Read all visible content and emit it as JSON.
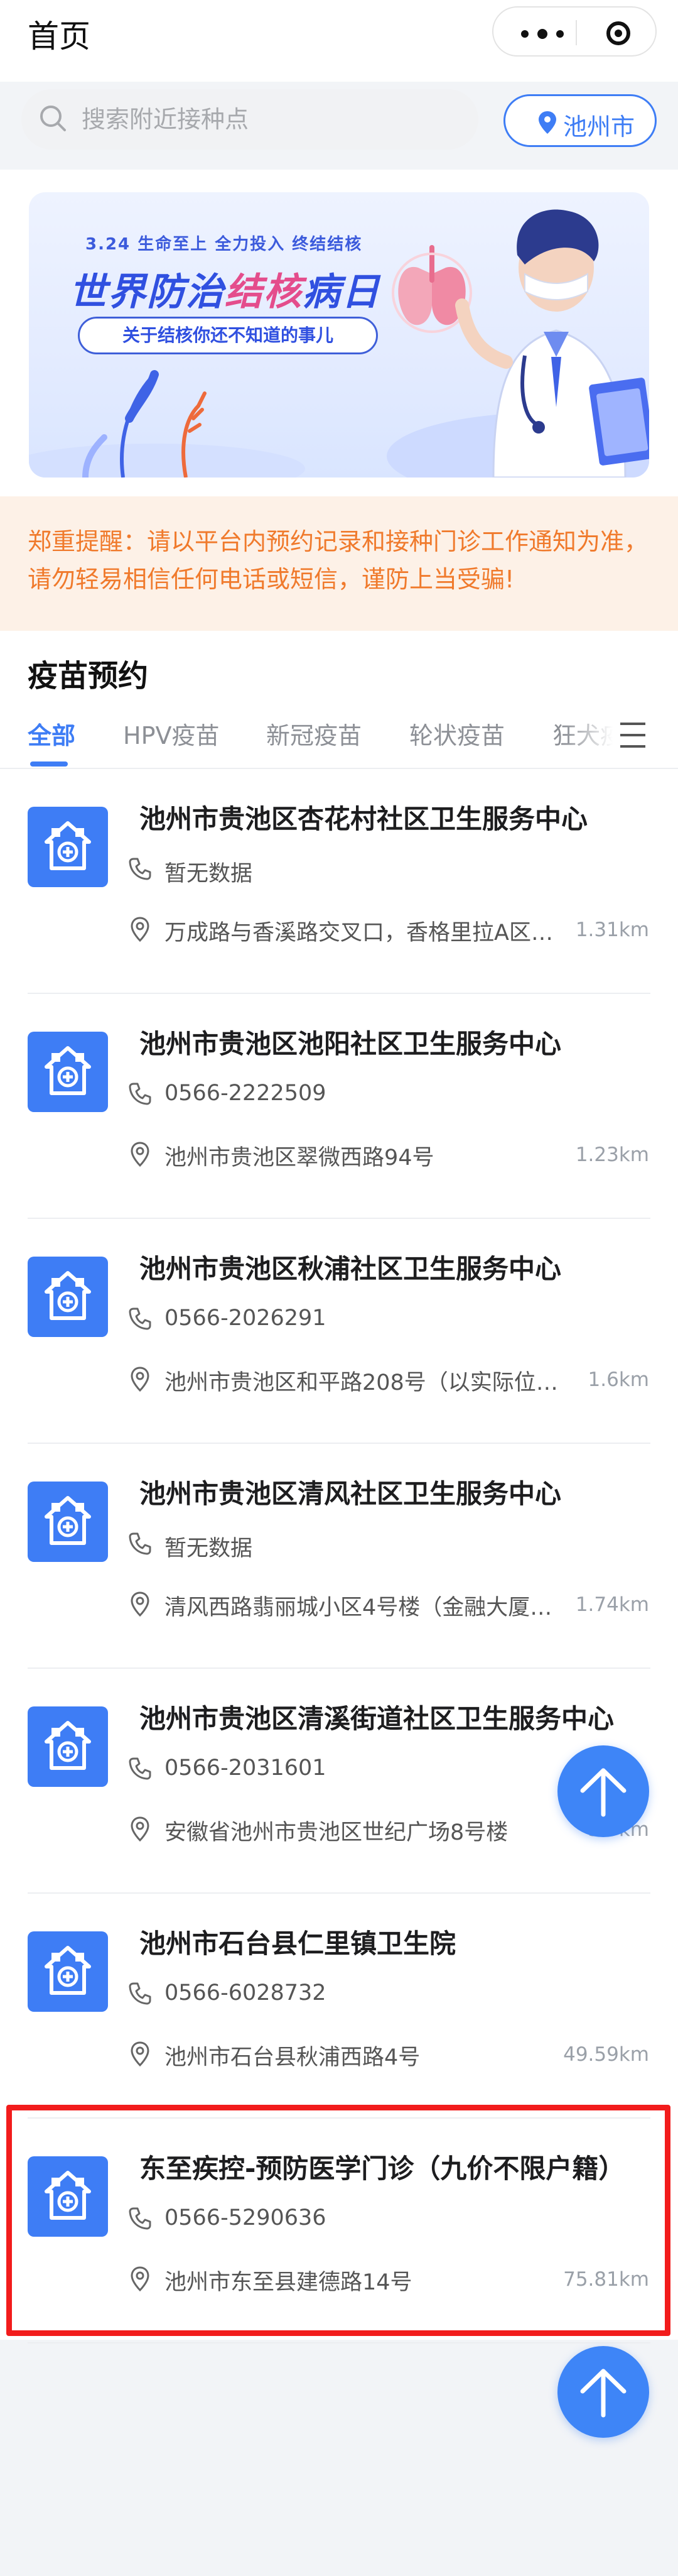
{
  "header": {
    "title": "首页"
  },
  "search": {
    "placeholder": "搜索附近接种点",
    "city": "池州市"
  },
  "banner": {
    "slogan": "3.24  生命至上  全力投入  终结结核",
    "title_part1": "世界防治",
    "title_part2": "结核",
    "title_part3": "病日",
    "pill": "关于结核你还不知道的事儿"
  },
  "notice": {
    "text": "郑重提醒：请以平台内预约记录和接种门诊工作通知为准，请勿轻易相信任何电话或短信，谨防上当受骗!"
  },
  "section": {
    "title": "疫苗预约",
    "tabs": [
      {
        "label": "全部"
      },
      {
        "label": "HPV疫苗"
      },
      {
        "label": "新冠疫苗"
      },
      {
        "label": "轮状疫苗"
      },
      {
        "label": "狂犬疫"
      }
    ]
  },
  "clinics": [
    {
      "name": "池州市贵池区杏花村社区卫生服务中心",
      "phone": "暂无数据",
      "address": "万成路与香溪路交叉口，香格里拉A区…",
      "distance": "1.31km"
    },
    {
      "name": "池州市贵池区池阳社区卫生服务中心",
      "phone": "0566-2222509",
      "address": "池州市贵池区翠微西路94号",
      "distance": "1.23km"
    },
    {
      "name": "池州市贵池区秋浦社区卫生服务中心",
      "phone": "0566-2026291",
      "address": "池州市贵池区和平路208号（以实际位置…",
      "distance": "1.6km"
    },
    {
      "name": "池州市贵池区清风社区卫生服务中心",
      "phone": "暂无数据",
      "address": "清风西路翡丽城小区4号楼（金融大厦…",
      "distance": "1.74km"
    },
    {
      "name": "池州市贵池区清溪街道社区卫生服务中心",
      "phone": "0566-2031601",
      "address": "安徽省池州市贵池区世纪广场8号楼",
      "distance": "5.7km"
    },
    {
      "name": "池州市石台县仁里镇卫生院",
      "phone": "0566-6028732",
      "address": "池州市石台县秋浦西路4号",
      "distance": "49.59km"
    },
    {
      "name": "东至疾控-预防医学门诊（九价不限户籍）",
      "phone": "0566-5290636",
      "address": "池州市东至县建德路14号",
      "distance": "75.81km"
    }
  ],
  "colors": {
    "accent": "#3e7df5",
    "notice": "#f07a2c",
    "highlight": "#f21c1c"
  }
}
